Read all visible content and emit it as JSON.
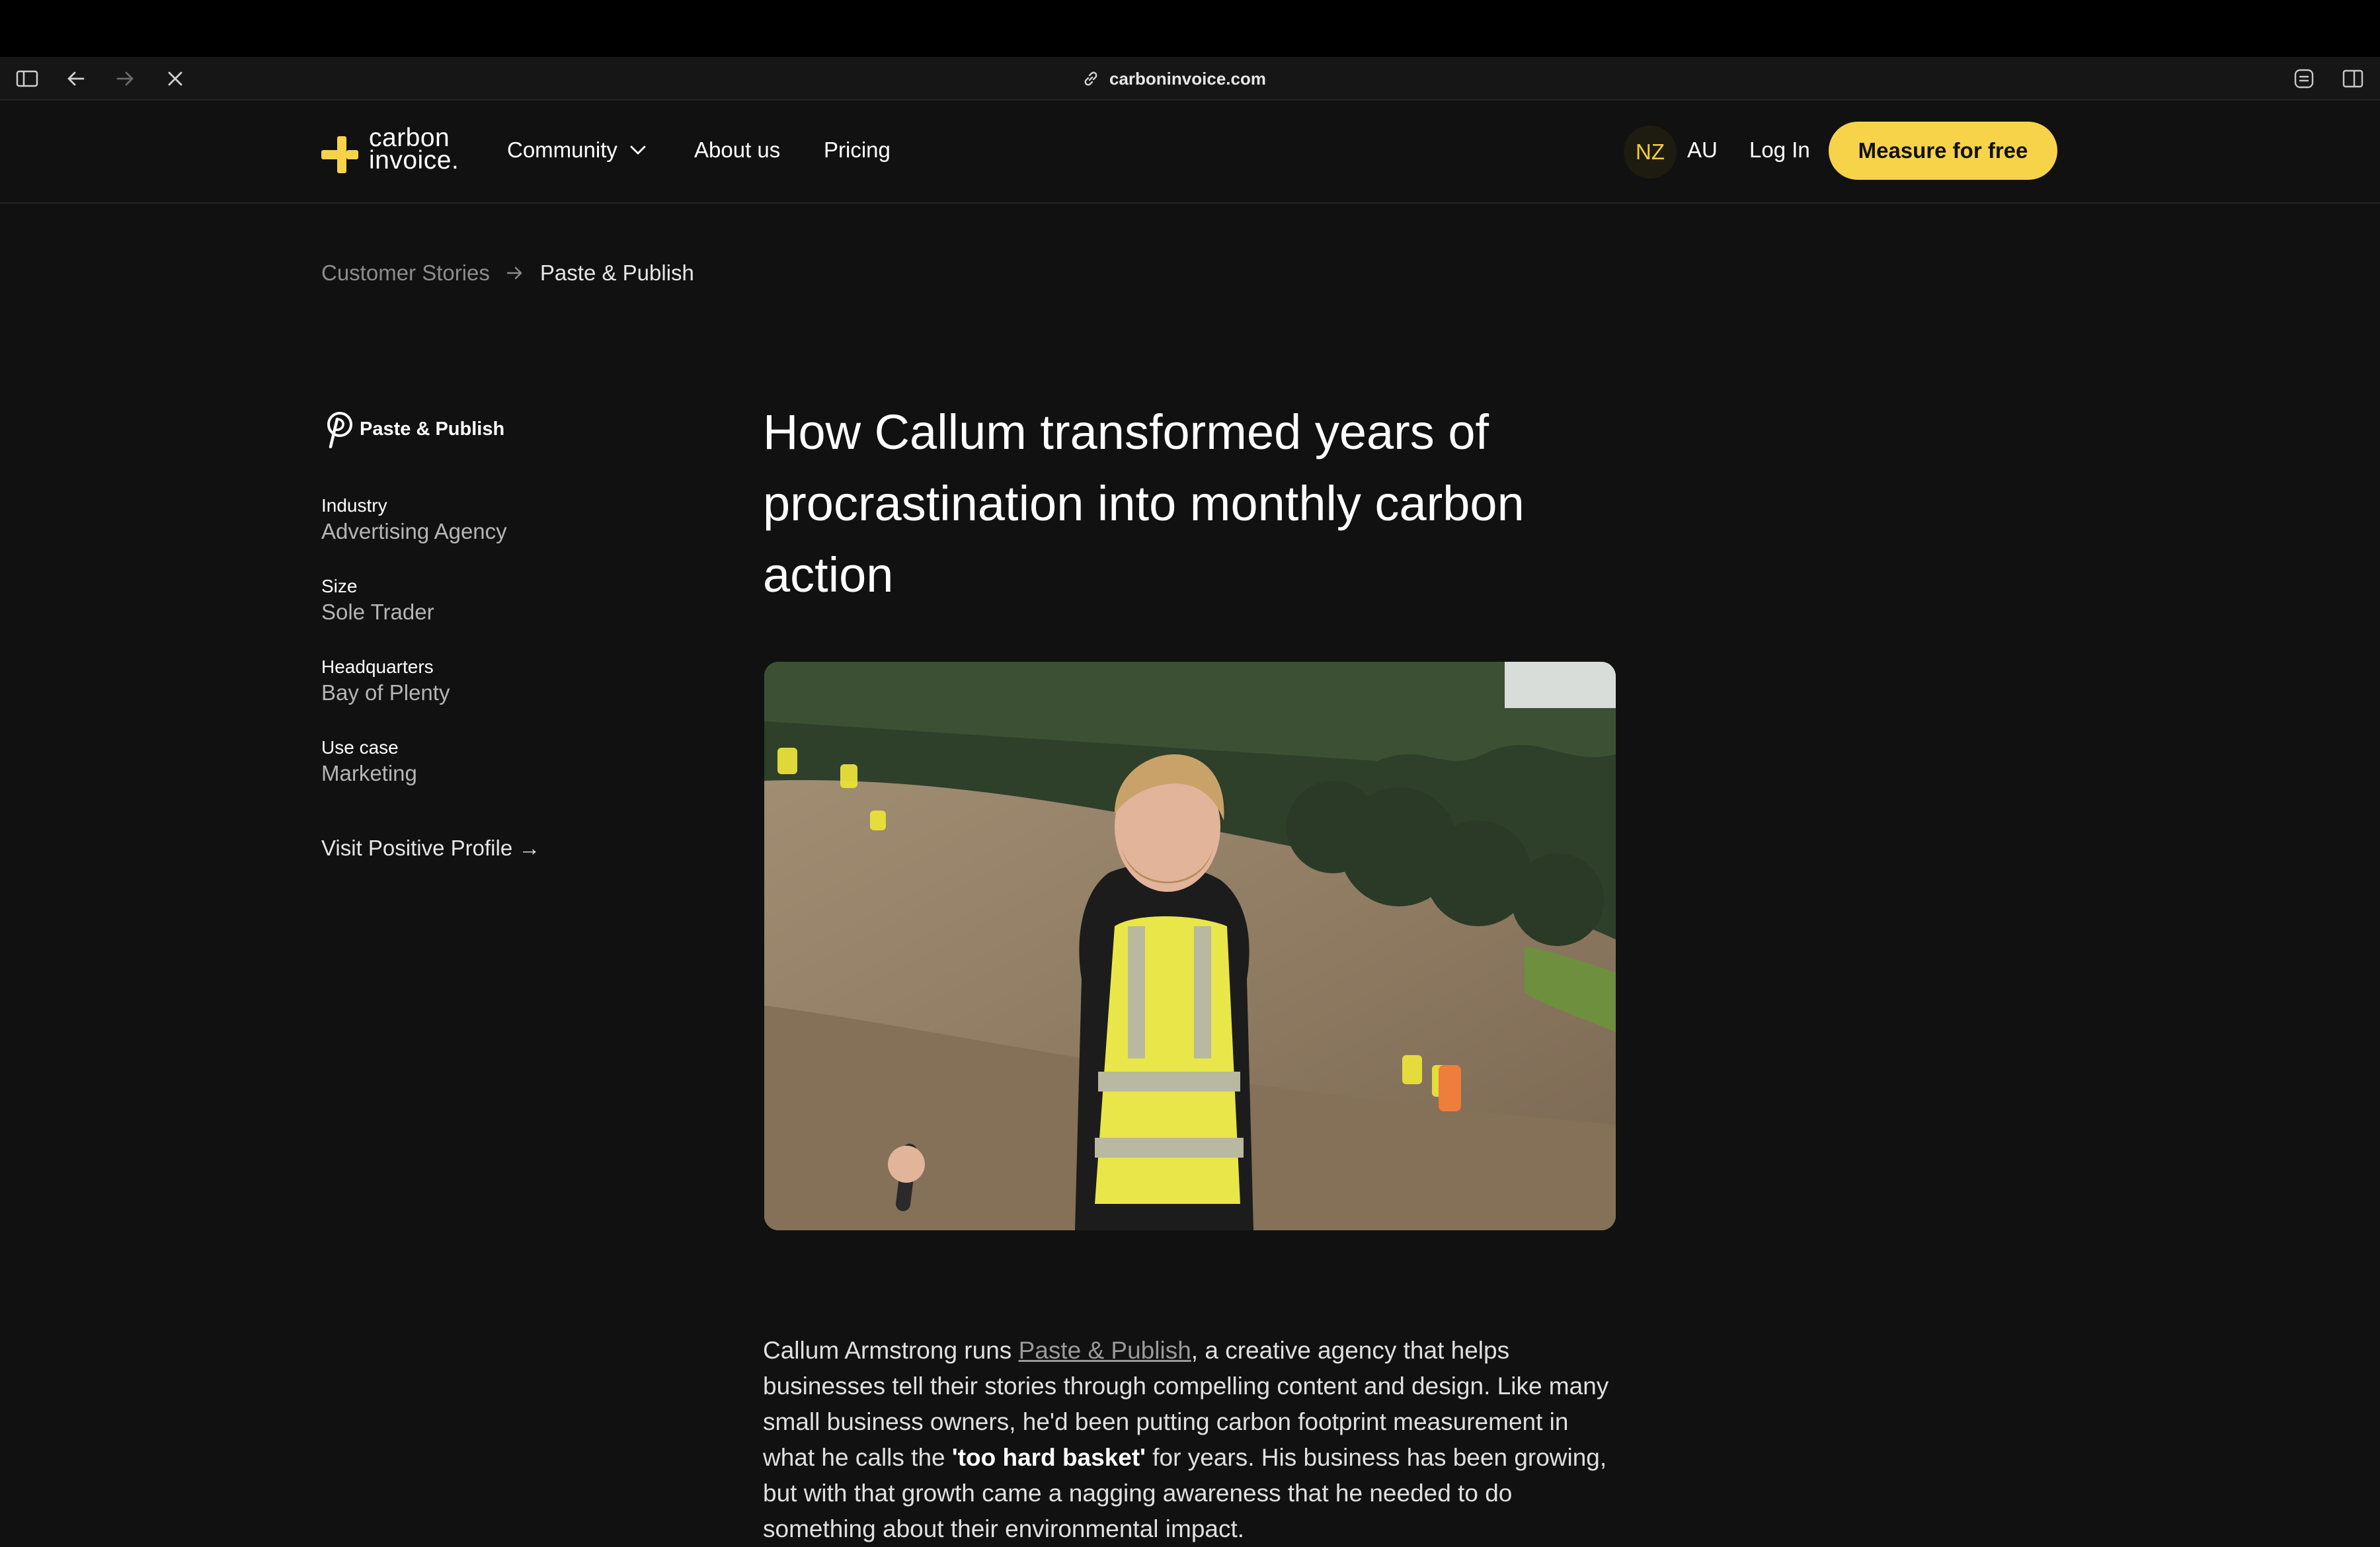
{
  "browser": {
    "url": "carboninvoice.com"
  },
  "nav": {
    "logo_line1": "carbon",
    "logo_line2": "invoice.",
    "community": "Community",
    "about": "About us",
    "pricing": "Pricing",
    "region_nz": "NZ",
    "region_au": "AU",
    "login": "Log In",
    "cta": "Measure for free"
  },
  "breadcrumb": {
    "parent": "Customer Stories",
    "current": "Paste & Publish"
  },
  "company": {
    "name": "Paste & Publish",
    "fields": [
      {
        "label": "Industry",
        "value": "Advertising Agency"
      },
      {
        "label": "Size",
        "value": "Sole Trader"
      },
      {
        "label": "Headquarters",
        "value": "Bay of Plenty"
      },
      {
        "label": "Use case",
        "value": "Marketing"
      }
    ],
    "profile_link": "Visit Positive Profile →"
  },
  "article": {
    "title": "How Callum transformed years of procrastination into monthly carbon action",
    "intro_before_link": "Callum Armstrong runs ",
    "intro_link": "Paste & Publish",
    "intro_after_link": ", a creative agency that helps businesses tell their stories through compelling content and design. Like many small business owners, he'd been putting carbon footprint measurement in what he calls the ",
    "intro_bold": "'too hard basket'",
    "intro_end": " for years. His business has been growing, but with that growth came a nagging awareness that he needed to do something about their environmental impact."
  },
  "colors": {
    "accent": "#f7d34a",
    "background": "#111111"
  }
}
